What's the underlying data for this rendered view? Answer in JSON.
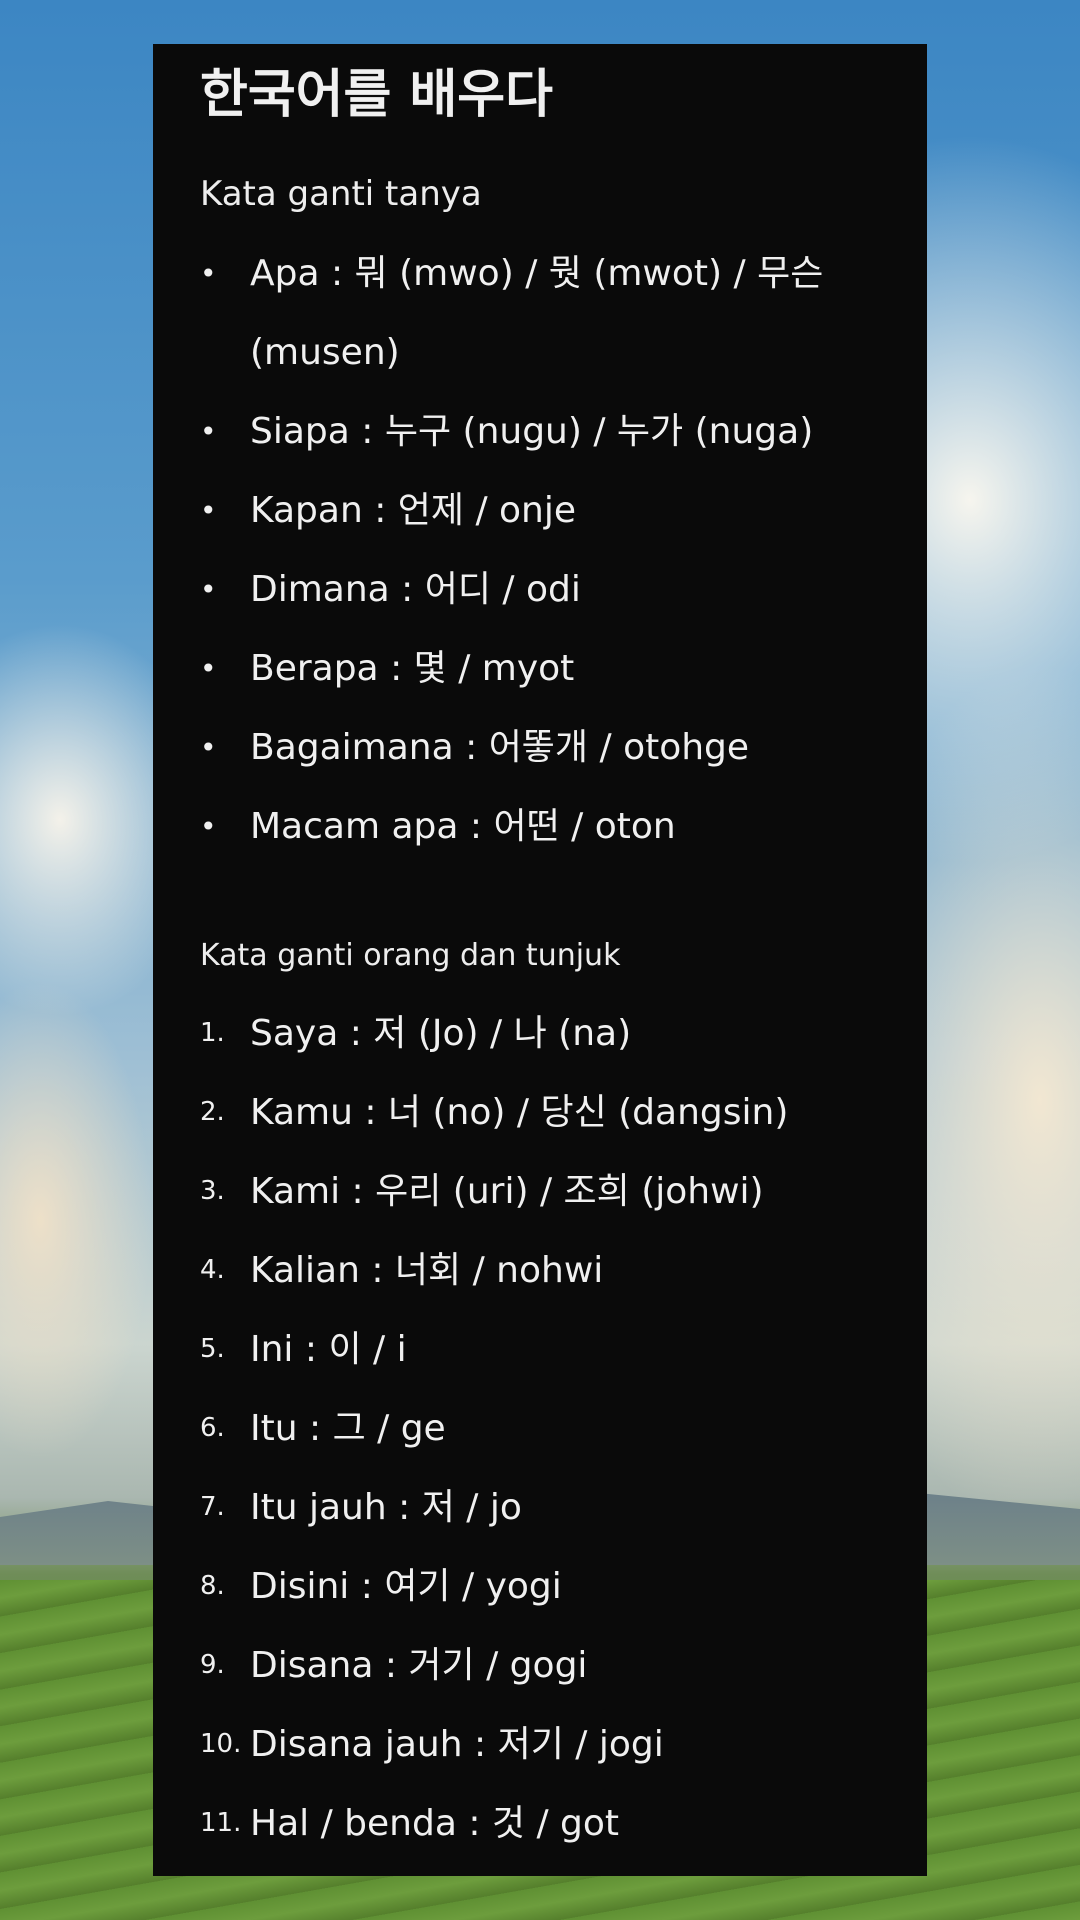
{
  "title": "한국어를 배우다",
  "section1": {
    "heading": "Kata ganti tanya",
    "items": [
      {
        "bullet": "•",
        "text": "Apa     : 뭐 (mwo) / 뭣 (mwot) / 무슨 (musen)"
      },
      {
        "bullet": "•",
        "text": "Siapa  : 누구 (nugu) / 누가 (nuga)"
      },
      {
        "bullet": "•",
        "text": "Kapan : 언제 / onje"
      },
      {
        "bullet": "•",
        "text": "Dimana : 어디 / odi"
      },
      {
        "bullet": "•",
        "text": "Berapa : 몇 / myot"
      },
      {
        "bullet": "•",
        "text": "Bagaimana : 어똫개 / otohge"
      },
      {
        "bullet": "•",
        "text": "Macam apa : 어떤 / oton"
      }
    ]
  },
  "section2": {
    "heading": "Kata ganti orang dan tunjuk",
    "items": [
      {
        "num": "1.",
        "text": "Saya  : 저 (Jo) / 나 (na)"
      },
      {
        "num": "2.",
        "text": "Kamu  : 너 (no) /  당신 (dangsin)"
      },
      {
        "num": "3.",
        "text": "Kami  : 우리 (uri) / 조희 (johwi)"
      },
      {
        "num": "4.",
        "text": "Kalian  : 너회 / nohwi"
      },
      {
        "num": "5.",
        "text": "Ini  : 이 / i"
      },
      {
        "num": "6.",
        "text": "Itu  : 그 / ge"
      },
      {
        "num": "7.",
        "text": "Itu jauh  : 저 / jo"
      },
      {
        "num": "8.",
        "text": "Disini  : 여기 / yogi"
      },
      {
        "num": "9.",
        "text": "Disana  : 거기 / gogi"
      },
      {
        "num": "10.",
        "text": "Disana jauh  : 저기 / jogi"
      },
      {
        "num": "11.",
        "text": "Hal / benda  : 것 / got"
      }
    ]
  }
}
